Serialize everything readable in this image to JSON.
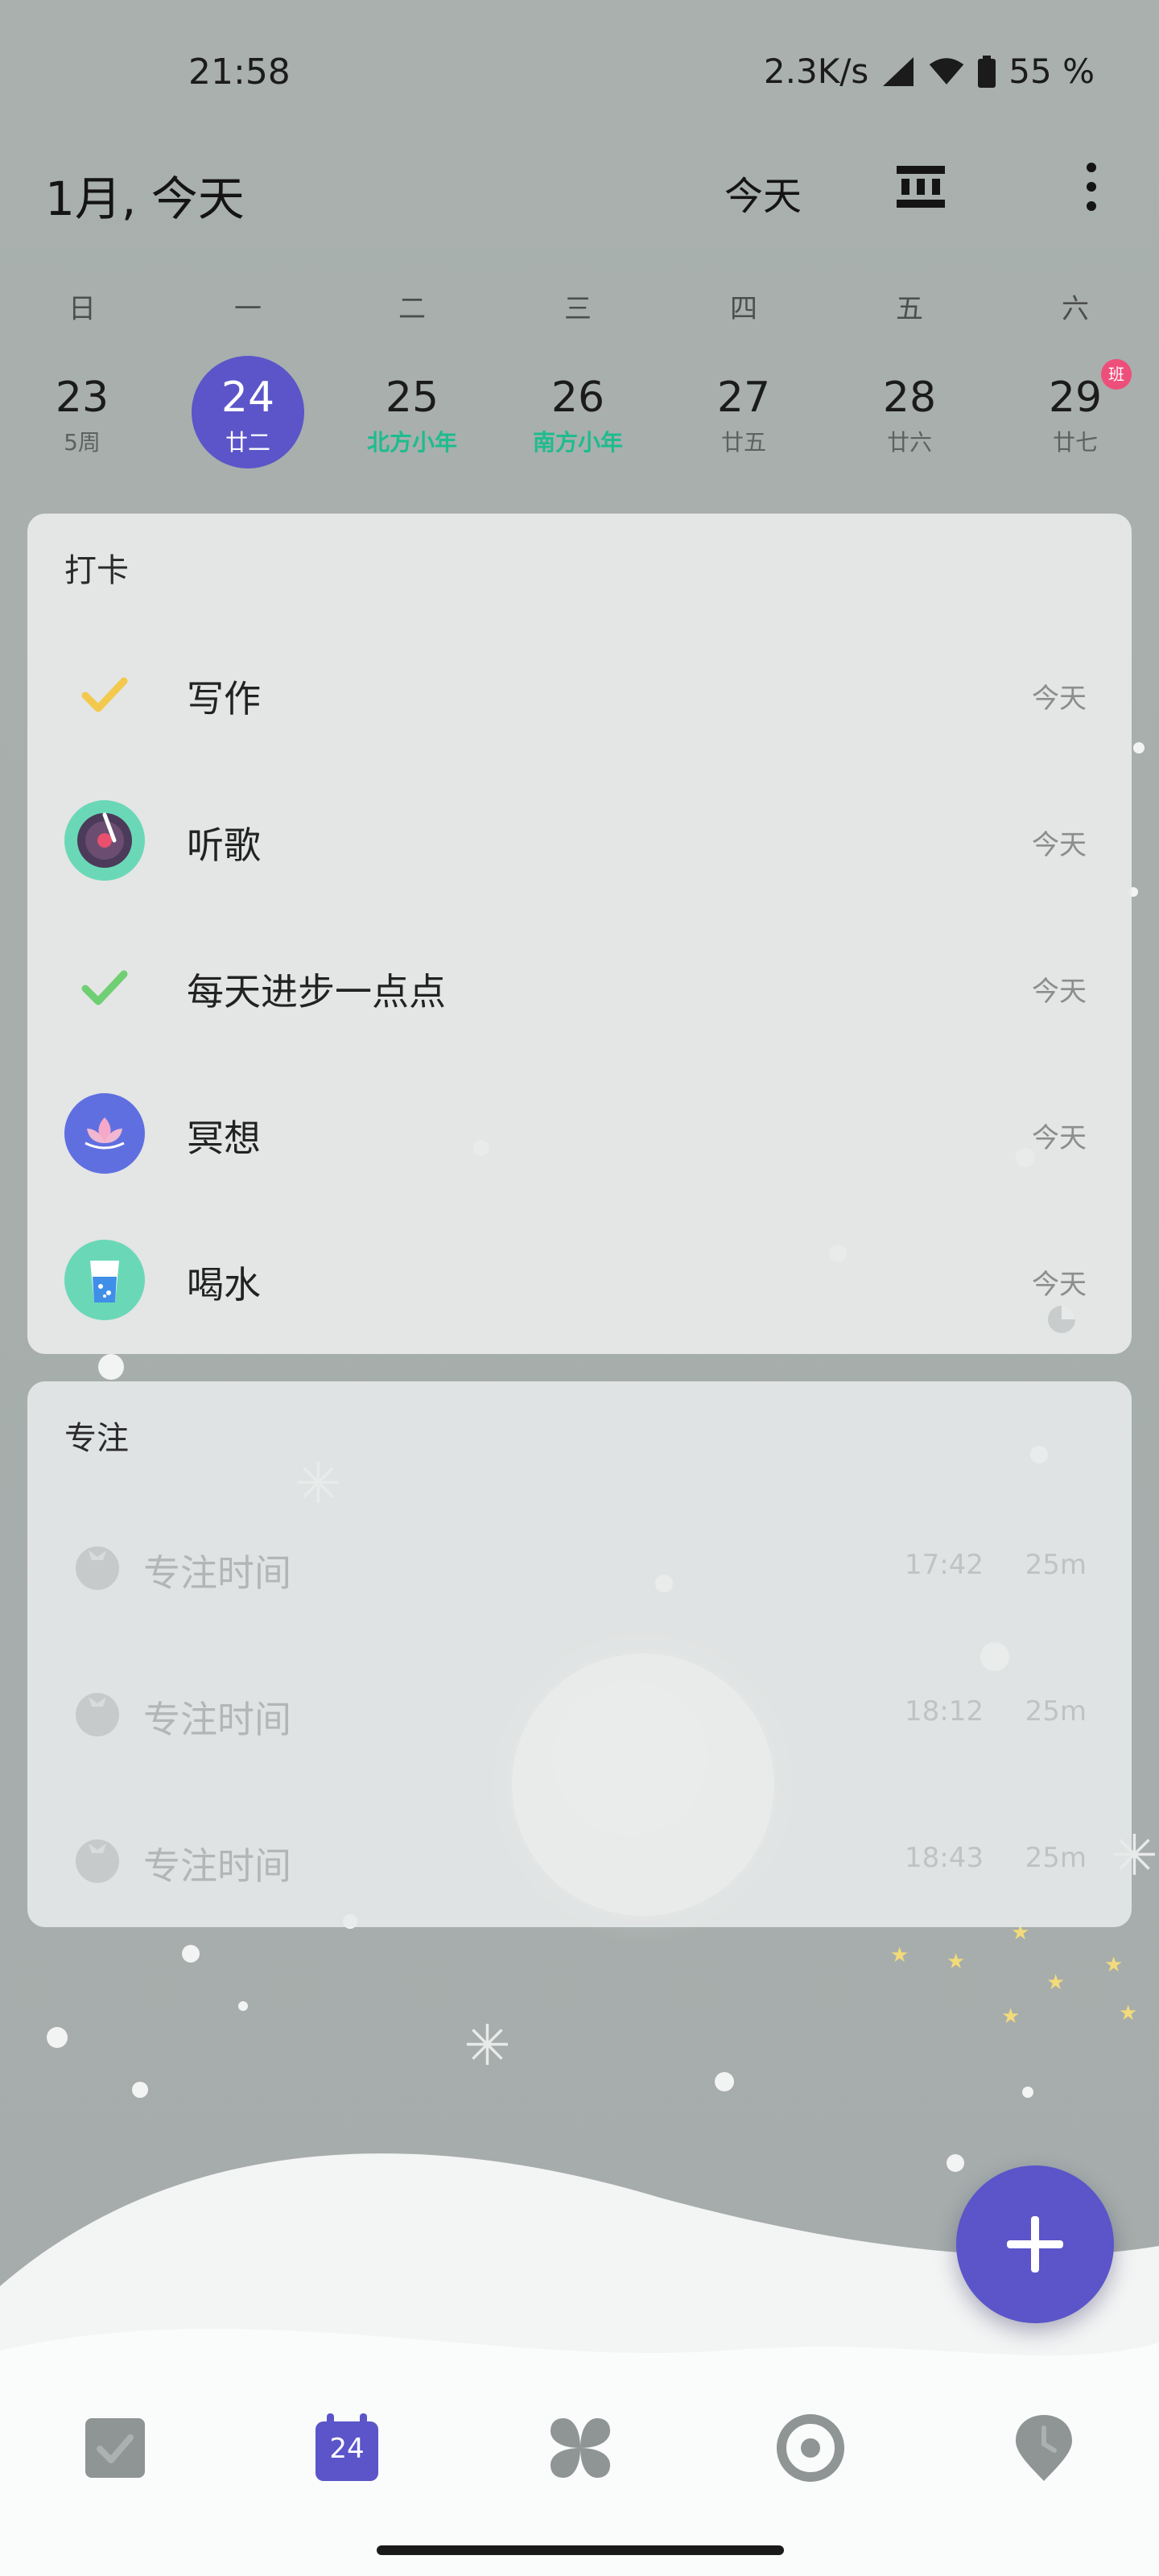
{
  "status_bar": {
    "time": "21:58",
    "network_speed": "2.3K/s",
    "battery": "55 %"
  },
  "header": {
    "title": "1月, 今天",
    "today_label": "今天"
  },
  "week": {
    "weekdays": [
      "日",
      "一",
      "二",
      "三",
      "四",
      "五",
      "六"
    ],
    "days": [
      {
        "num": "23",
        "sub": "5周"
      },
      {
        "num": "24",
        "sub": "廿二",
        "selected": true
      },
      {
        "num": "25",
        "sub": "北方小年",
        "festival": true
      },
      {
        "num": "26",
        "sub": "南方小年",
        "festival": true
      },
      {
        "num": "27",
        "sub": "廿五"
      },
      {
        "num": "28",
        "sub": "廿六"
      },
      {
        "num": "29",
        "sub": "廿七",
        "badge": "班"
      }
    ]
  },
  "checkin": {
    "title": "打卡",
    "items": [
      {
        "name": "写作",
        "date": "今天",
        "icon": "check-icon-yellow"
      },
      {
        "name": "听歌",
        "date": "今天",
        "icon": "music-disc-icon"
      },
      {
        "name": "每天进步一点点",
        "date": "今天",
        "icon": "check-icon-green"
      },
      {
        "name": "冥想",
        "date": "今天",
        "icon": "lotus-icon"
      },
      {
        "name": "喝水",
        "date": "今天",
        "icon": "water-glass-icon"
      }
    ]
  },
  "focus": {
    "title": "专注",
    "items": [
      {
        "name": "专注时间",
        "time": "17:42",
        "duration": "25m"
      },
      {
        "name": "专注时间",
        "time": "18:12",
        "duration": "25m"
      },
      {
        "name": "专注时间",
        "time": "18:43",
        "duration": "25m"
      }
    ]
  },
  "bottom_nav": {
    "calendar_day": "24",
    "items": [
      "task-icon",
      "calendar-icon",
      "grid-icon",
      "focus-icon",
      "pomodoro-icon"
    ]
  },
  "colors": {
    "accent": "#5b55c9",
    "festival": "#1ebc8d",
    "badge": "#ee4f7a"
  }
}
